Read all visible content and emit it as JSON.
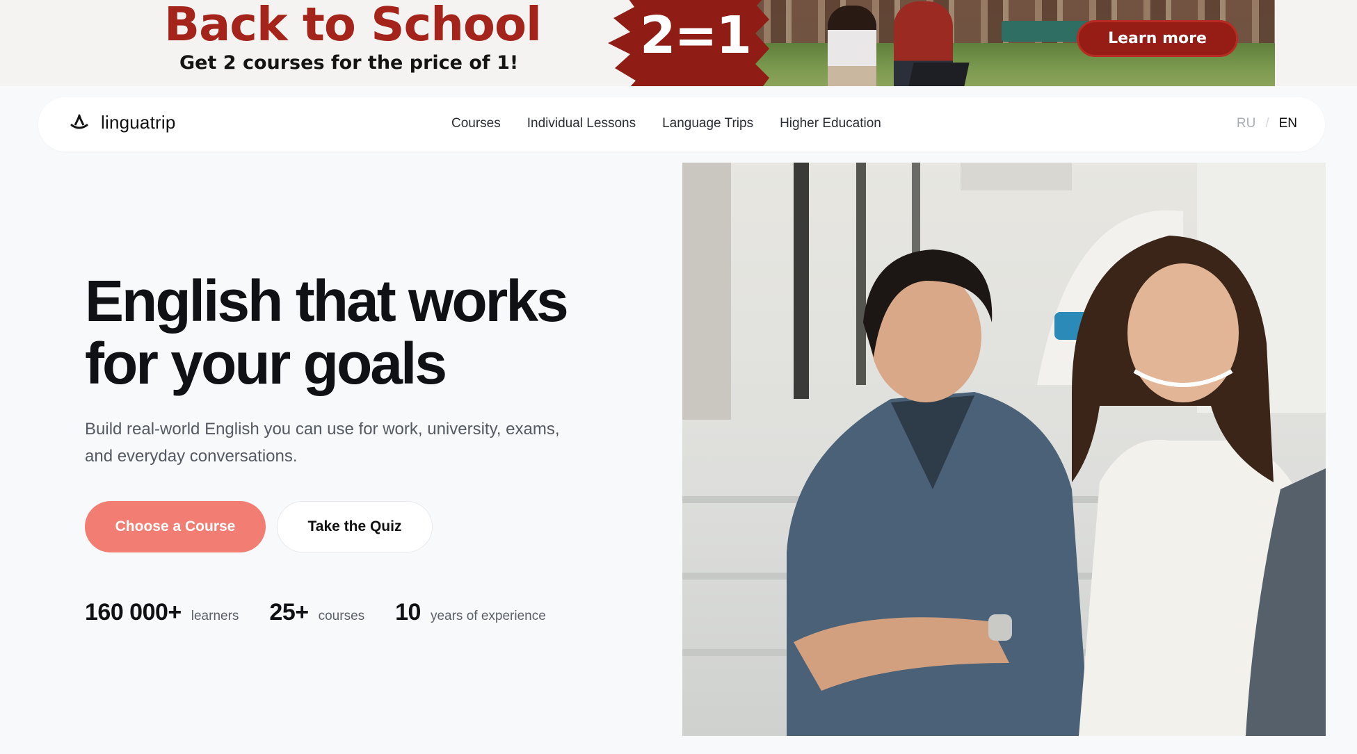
{
  "promo": {
    "title": "Back to School",
    "subtitle": "Get 2 courses for the price of 1!",
    "badge": "2=1",
    "cta": "Learn more",
    "colors": {
      "accent": "#a4231a",
      "badge": "#8f1d16"
    }
  },
  "header": {
    "logo_text": "linguatrip",
    "nav": [
      "Courses",
      "Individual Lessons",
      "Language Trips",
      "Higher Education"
    ],
    "lang": {
      "ru": "RU",
      "separator": "/",
      "en": "EN",
      "active": "EN"
    }
  },
  "hero": {
    "title_lines": [
      "English that works",
      "for your goals"
    ],
    "description_lines": [
      "Build real-world English you can use for work, university, exams,",
      "and everyday conversations."
    ],
    "primary_cta": "Choose a Course",
    "secondary_cta": "Take the Quiz",
    "stats": [
      {
        "value": "160 000+",
        "label": "learners"
      },
      {
        "value": "25+",
        "label": "courses"
      },
      {
        "value": "10",
        "label": "years of experience"
      }
    ],
    "colors": {
      "primary_button": "#f27d72"
    }
  }
}
